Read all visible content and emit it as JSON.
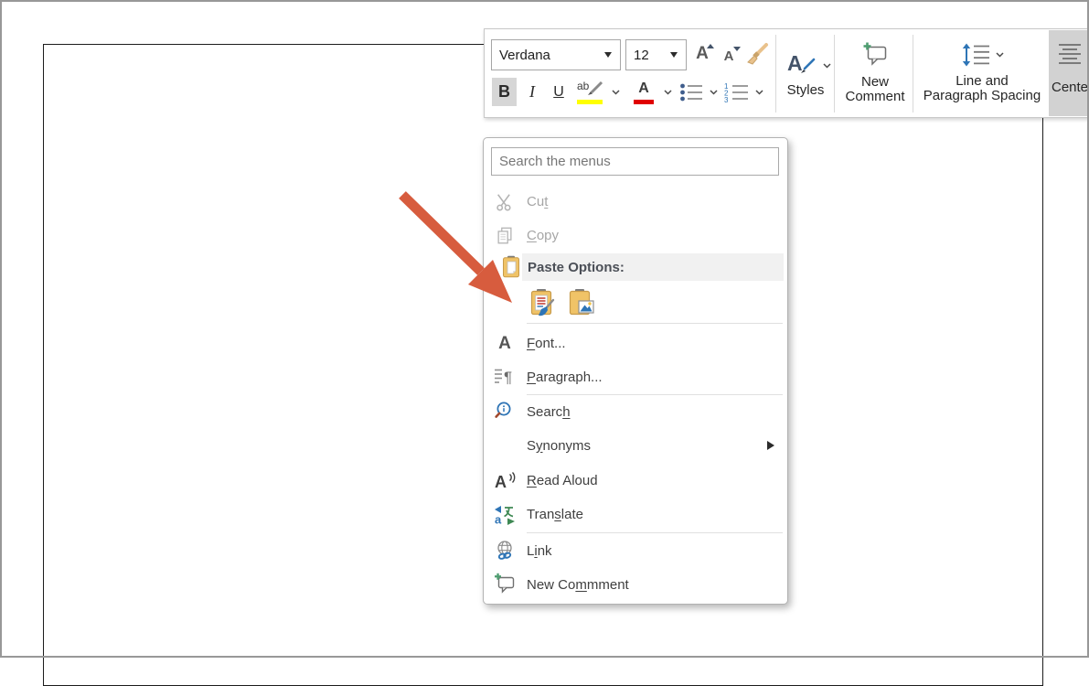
{
  "toolbar": {
    "font_name_value": "Verdana",
    "font_size_value": "12",
    "grow_font_letter": "A",
    "shrink_font_letter": "A",
    "bold_letter": "B",
    "italic_letter": "I",
    "underline_letter": "U",
    "highlight_text": "ab",
    "font_color_letter": "A",
    "styles_letter": "A",
    "styles_label": "Styles",
    "new_comment_line1": "New",
    "new_comment_line2": "Comment",
    "line_spacing_line1": "Line and",
    "line_spacing_line2": "Paragraph Spacing",
    "center_label": "Cente"
  },
  "context_menu": {
    "search_placeholder": "Search the menus",
    "cut": {
      "pre": "Cu",
      "key": "t",
      "post": ""
    },
    "copy": {
      "pre": "",
      "key": "C",
      "post": "opy"
    },
    "paste_options_header": "Paste Options:",
    "font": {
      "pre": "",
      "key": "F",
      "post": "ont..."
    },
    "paragraph": {
      "pre": "",
      "key": "P",
      "post": "aragraph..."
    },
    "search": {
      "pre": "Searc",
      "key": "h",
      "post": ""
    },
    "synonyms": {
      "pre": "S",
      "key": "y",
      "post": "nonyms"
    },
    "read_aloud": {
      "pre": "",
      "key": "R",
      "post": "ead Aloud"
    },
    "translate": {
      "pre": "Tran",
      "key": "s",
      "post": "late"
    },
    "link": {
      "pre": "L",
      "key": "i",
      "post": "nk"
    },
    "new_comment": {
      "pre": "New Co",
      "key": "m",
      "post": "mment"
    },
    "font_icon_letter": "A",
    "read_aloud_icon_letter": "A",
    "paragraph_mark": "¶",
    "translate_icon_letter": "a"
  },
  "icons": {
    "scissors-icon": "svg scissors shape, gray",
    "copy-icon": "two overlapping pages, gray outline",
    "clipboard-icon": "tan clipboard with white sheet",
    "paste-keep-formatting-icon": "clipboard with red/blue text lines and blue brush",
    "paste-picture-icon": "clipboard with small landscape picture",
    "paragraph-icon": "pilcrow with text lines",
    "search-info-icon": "blue magnifier with info dot",
    "read-aloud-icon": "letter A with sound waves",
    "translate-icon": "green kana and blue a with arrows",
    "link-icon": "gray globe with blue chain",
    "new-comment-icon": "speech bubble with green plus",
    "format-painter-icon": "tan paint brush",
    "styles-icon": "letter A with blue pen",
    "line-spacing-icon": "blue vertical double arrow with lines",
    "center-align-icon": "centered text lines",
    "bullet-list-icon": "blue dots with lines",
    "numbered-list-icon": "blue 1 2 3 with lines",
    "dropdown-arrow": "▼",
    "submenu-arrow": "▶"
  },
  "colors": {
    "accent_blue": "#2e75b6",
    "arrow_red": "#d75c3e",
    "highlight_yellow": "#ffff00",
    "font_color_red": "#e00000",
    "clipboard_tan": "#f0c367",
    "paste_header_bg": "#f1f1f1",
    "selected_button_bg": "#d6d6d6",
    "disabled_text": "#a6a6a6",
    "menu_text": "#3f3f3f"
  }
}
